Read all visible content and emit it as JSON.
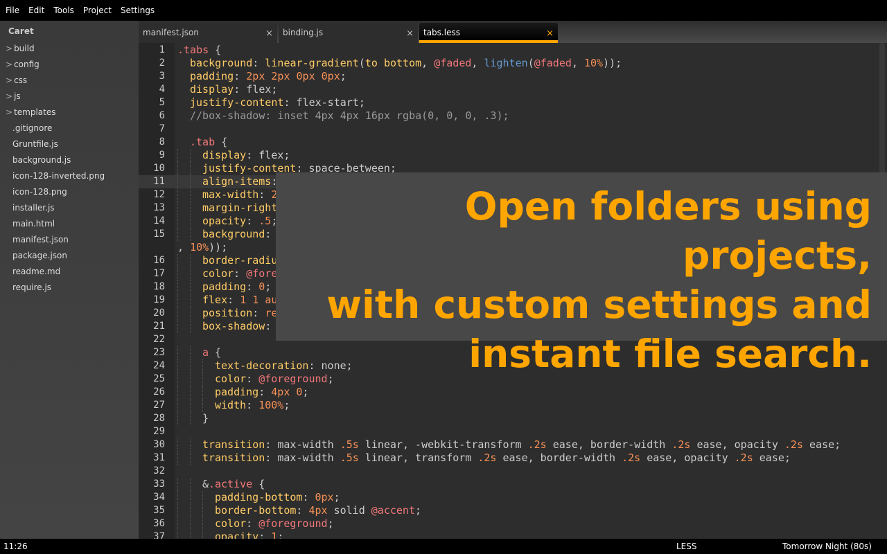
{
  "menu": [
    "File",
    "Edit",
    "Tools",
    "Project",
    "Settings"
  ],
  "sidebar": {
    "title": "Caret",
    "items": [
      {
        "label": "build",
        "dir": true
      },
      {
        "label": "config",
        "dir": true
      },
      {
        "label": "css",
        "dir": true
      },
      {
        "label": "js",
        "dir": true
      },
      {
        "label": "templates",
        "dir": true
      },
      {
        "label": ".gitignore"
      },
      {
        "label": "Gruntfile.js"
      },
      {
        "label": "background.js"
      },
      {
        "label": "icon-128-inverted.png"
      },
      {
        "label": "icon-128.png"
      },
      {
        "label": "installer.js"
      },
      {
        "label": "main.html"
      },
      {
        "label": "manifest.json"
      },
      {
        "label": "package.json"
      },
      {
        "label": "readme.md"
      },
      {
        "label": "require.js"
      }
    ]
  },
  "tabs": [
    {
      "label": "manifest.json",
      "close": "×",
      "active": false
    },
    {
      "label": "binding.js",
      "close": "×",
      "active": false
    },
    {
      "label": "tabs.less",
      "close": "×",
      "active": true
    }
  ],
  "accent": "#ffa500",
  "editor": {
    "current_line": 11,
    "fold_lines": [
      1,
      8,
      23,
      33
    ],
    "lines": [
      {
        "n": 1,
        "i": 0,
        "t": [
          [
            "s",
            ".tabs"
          ],
          [
            "t",
            " {"
          ]
        ]
      },
      {
        "n": 2,
        "i": 1,
        "t": [
          [
            "p",
            "background"
          ],
          [
            "t",
            ": "
          ],
          [
            "p",
            "linear-gradient"
          ],
          [
            "t",
            "("
          ],
          [
            "p",
            "to bottom"
          ],
          [
            "t",
            ", "
          ],
          [
            "v",
            "@faded"
          ],
          [
            "t",
            ", "
          ],
          [
            "f",
            "lighten"
          ],
          [
            "t",
            "("
          ],
          [
            "v",
            "@faded"
          ],
          [
            "t",
            ", "
          ],
          [
            "n",
            "10%"
          ],
          [
            "t",
            "));"
          ]
        ]
      },
      {
        "n": 3,
        "i": 1,
        "t": [
          [
            "p",
            "padding"
          ],
          [
            "t",
            ": "
          ],
          [
            "n",
            "2px 2px 0px 0px"
          ],
          [
            "t",
            ";"
          ]
        ]
      },
      {
        "n": 4,
        "i": 1,
        "t": [
          [
            "p",
            "display"
          ],
          [
            "t",
            ": flex;"
          ]
        ]
      },
      {
        "n": 5,
        "i": 1,
        "t": [
          [
            "p",
            "justify-content"
          ],
          [
            "t",
            ": flex-start;"
          ]
        ]
      },
      {
        "n": 6,
        "i": 1,
        "t": [
          [
            "c",
            "//box-shadow: inset 4px 4px 16px rgba(0, 0, 0, .3);"
          ]
        ]
      },
      {
        "n": 7,
        "i": 0,
        "t": []
      },
      {
        "n": 8,
        "i": 1,
        "t": [
          [
            "s",
            ".tab"
          ],
          [
            "t",
            " {"
          ]
        ]
      },
      {
        "n": 9,
        "i": 2,
        "t": [
          [
            "p",
            "display"
          ],
          [
            "t",
            ": flex;"
          ]
        ]
      },
      {
        "n": 10,
        "i": 2,
        "t": [
          [
            "p",
            "justify-content"
          ],
          [
            "t",
            ": space-between;"
          ]
        ]
      },
      {
        "n": 11,
        "i": 2,
        "t": [
          [
            "p",
            "align-items"
          ],
          [
            "t",
            ":"
          ]
        ]
      },
      {
        "n": 12,
        "i": 2,
        "t": [
          [
            "p",
            "max-width"
          ],
          [
            "t",
            ": "
          ],
          [
            "n",
            "2"
          ]
        ]
      },
      {
        "n": 13,
        "i": 2,
        "t": [
          [
            "p",
            "margin-right"
          ]
        ]
      },
      {
        "n": 14,
        "i": 2,
        "t": [
          [
            "p",
            "opacity"
          ],
          [
            "t",
            ": "
          ],
          [
            "n",
            ".5"
          ],
          [
            "t",
            ";"
          ]
        ]
      },
      {
        "n": 15,
        "i": 2,
        "t": [
          [
            "p",
            "background"
          ],
          [
            "t",
            ":"
          ]
        ]
      },
      {
        "n": null,
        "i": 0,
        "t": [
          [
            "t",
            ", "
          ],
          [
            "n",
            "10%"
          ],
          [
            "t",
            "));"
          ]
        ]
      },
      {
        "n": 16,
        "i": 2,
        "t": [
          [
            "p",
            "border-radiu"
          ]
        ]
      },
      {
        "n": 17,
        "i": 2,
        "t": [
          [
            "p",
            "color"
          ],
          [
            "t",
            ": "
          ],
          [
            "v",
            "@fore"
          ]
        ]
      },
      {
        "n": 18,
        "i": 2,
        "t": [
          [
            "p",
            "padding"
          ],
          [
            "t",
            ": "
          ],
          [
            "n",
            "0"
          ],
          [
            "t",
            ";"
          ]
        ]
      },
      {
        "n": 19,
        "i": 2,
        "t": [
          [
            "p",
            "flex"
          ],
          [
            "t",
            ": "
          ],
          [
            "n",
            "1 1"
          ],
          [
            "t",
            " "
          ],
          [
            "n",
            "au"
          ]
        ]
      },
      {
        "n": 20,
        "i": 2,
        "t": [
          [
            "p",
            "position"
          ],
          [
            "t",
            ": "
          ],
          [
            "n",
            "re"
          ]
        ]
      },
      {
        "n": 21,
        "i": 2,
        "t": [
          [
            "p",
            "box-shadow"
          ],
          [
            "t",
            ":"
          ]
        ]
      },
      {
        "n": 22,
        "i": 0,
        "t": []
      },
      {
        "n": 23,
        "i": 2,
        "t": [
          [
            "s",
            "a"
          ],
          [
            "t",
            " {"
          ]
        ]
      },
      {
        "n": 24,
        "i": 3,
        "t": [
          [
            "p",
            "text-decoration"
          ],
          [
            "t",
            ": none;"
          ]
        ]
      },
      {
        "n": 25,
        "i": 3,
        "t": [
          [
            "p",
            "color"
          ],
          [
            "t",
            ": "
          ],
          [
            "v",
            "@foreground"
          ],
          [
            "t",
            ";"
          ]
        ]
      },
      {
        "n": 26,
        "i": 3,
        "t": [
          [
            "p",
            "padding"
          ],
          [
            "t",
            ": "
          ],
          [
            "n",
            "4px 0"
          ],
          [
            "t",
            ";"
          ]
        ]
      },
      {
        "n": 27,
        "i": 3,
        "t": [
          [
            "p",
            "width"
          ],
          [
            "t",
            ": "
          ],
          [
            "n",
            "100%"
          ],
          [
            "t",
            ";"
          ]
        ]
      },
      {
        "n": 28,
        "i": 2,
        "t": [
          [
            "t",
            "}"
          ]
        ]
      },
      {
        "n": 29,
        "i": 0,
        "t": []
      },
      {
        "n": 30,
        "i": 2,
        "t": [
          [
            "p",
            "transition"
          ],
          [
            "t",
            ": max-width "
          ],
          [
            "n",
            ".5s"
          ],
          [
            "t",
            " linear, -webkit-transform "
          ],
          [
            "n",
            ".2s"
          ],
          [
            "t",
            " ease, border-width "
          ],
          [
            "n",
            ".2s"
          ],
          [
            "t",
            " ease, opacity "
          ],
          [
            "n",
            ".2s"
          ],
          [
            "t",
            " ease;"
          ]
        ]
      },
      {
        "n": 31,
        "i": 2,
        "t": [
          [
            "p",
            "transition"
          ],
          [
            "t",
            ": max-width "
          ],
          [
            "n",
            ".5s"
          ],
          [
            "t",
            " linear, transform "
          ],
          [
            "n",
            ".2s"
          ],
          [
            "t",
            " ease, border-width "
          ],
          [
            "n",
            ".2s"
          ],
          [
            "t",
            " ease, opacity "
          ],
          [
            "n",
            ".2s"
          ],
          [
            "t",
            " ease;"
          ]
        ]
      },
      {
        "n": 32,
        "i": 0,
        "t": []
      },
      {
        "n": 33,
        "i": 2,
        "t": [
          [
            "t",
            "&"
          ],
          [
            "s",
            ".active"
          ],
          [
            "t",
            " {"
          ]
        ]
      },
      {
        "n": 34,
        "i": 3,
        "t": [
          [
            "p",
            "padding-bottom"
          ],
          [
            "t",
            ": "
          ],
          [
            "n",
            "0px"
          ],
          [
            "t",
            ";"
          ]
        ]
      },
      {
        "n": 35,
        "i": 3,
        "t": [
          [
            "p",
            "border-bottom"
          ],
          [
            "t",
            ": "
          ],
          [
            "n",
            "4px"
          ],
          [
            "t",
            " solid "
          ],
          [
            "v",
            "@accent"
          ],
          [
            "t",
            ";"
          ]
        ]
      },
      {
        "n": 36,
        "i": 3,
        "t": [
          [
            "p",
            "color"
          ],
          [
            "t",
            ": "
          ],
          [
            "v",
            "@foreground"
          ],
          [
            "t",
            ";"
          ]
        ]
      },
      {
        "n": 37,
        "i": 3,
        "t": [
          [
            "p",
            "opacity"
          ],
          [
            "t",
            ": "
          ],
          [
            "n",
            "1"
          ],
          [
            "t",
            ";"
          ]
        ]
      }
    ]
  },
  "overlay": {
    "lines": [
      "Open folders using projects,",
      "with custom settings and",
      "instant file search."
    ]
  },
  "status": {
    "time": "11:26",
    "mode": "LESS",
    "theme": "Tomorrow Night (80s)"
  }
}
